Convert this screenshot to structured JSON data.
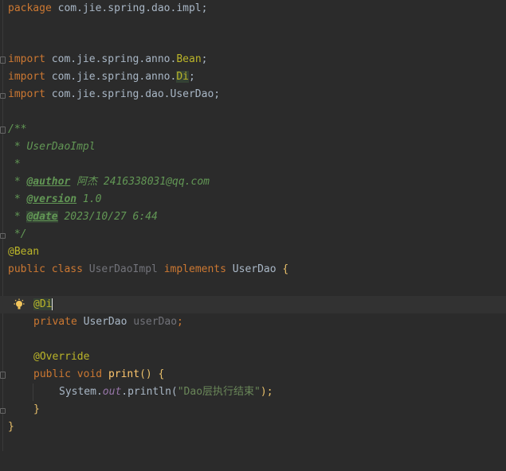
{
  "editor": {
    "lines": {
      "l1": {
        "kw": "package",
        "rest": " com.jie.spring.dao.impl;"
      },
      "l4": {
        "kw": "import",
        "pkg": " com.jie.spring.anno.",
        "cls": "Bean",
        "end": ";"
      },
      "l5": {
        "kw": "import",
        "pkg": " com.jie.spring.anno.",
        "cls": "Di",
        "end": ";"
      },
      "l6": {
        "kw": "import",
        "rest": " com.jie.spring.dao.UserDao;"
      },
      "l8": "/**",
      "l9": " * UserDaoImpl",
      "l10": " *",
      "l11": {
        "pre": " * ",
        "tag": "@author",
        "rest": " 阿杰 2416338031@qq.com"
      },
      "l12": {
        "pre": " * ",
        "tag": "@version",
        "rest": " 1.0"
      },
      "l13": {
        "pre": " * ",
        "tag": "@date",
        "rest": " 2023/10/27 6:44"
      },
      "l14": " */",
      "l15": "@Bean",
      "l16": {
        "kw1": "public",
        "kw2": "class",
        "cls": "UserDaoImpl",
        "kw3": "implements",
        "iface": "UserDao",
        "brace": "{"
      },
      "l18": "@Di",
      "l19": {
        "kw": "private",
        "type": "UserDao",
        "field": "userDao",
        "end": ";"
      },
      "l21": "@Override",
      "l22": {
        "kw1": "public",
        "kw2": "void",
        "method": "print",
        "rest": "() {"
      },
      "l23": {
        "pre": "System.",
        "field": "out",
        "call": ".println(",
        "str": "\"Dao层执行结束\"",
        "end": ");"
      },
      "l24": "}",
      "l25": "}"
    }
  }
}
